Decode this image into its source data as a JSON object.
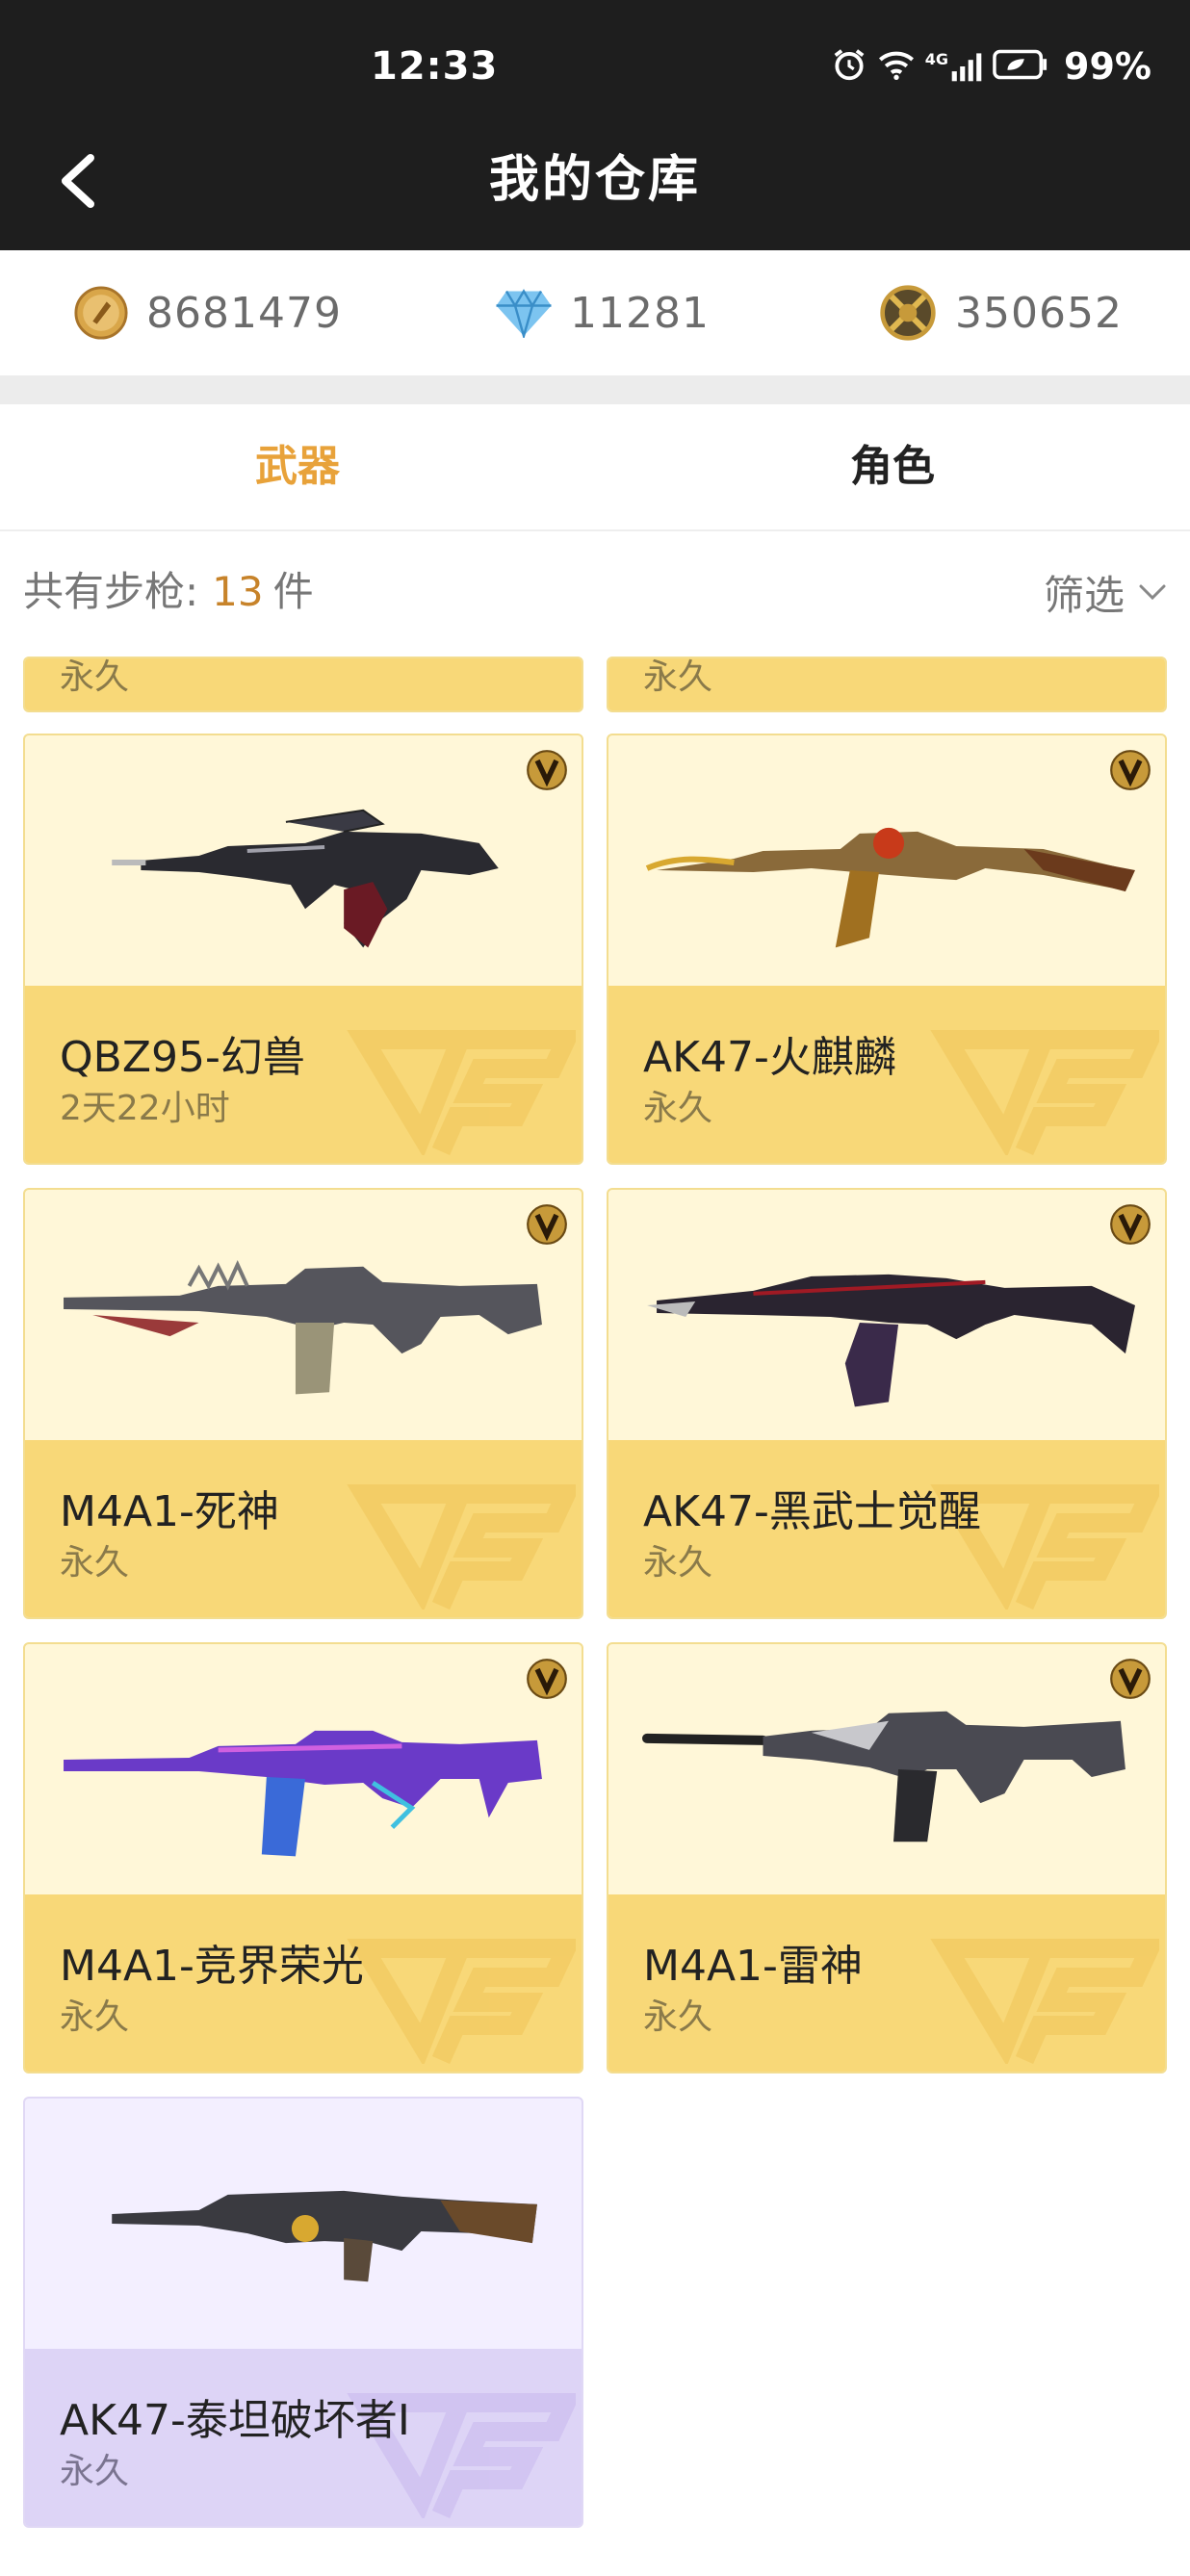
{
  "status_bar": {
    "time": "12:33",
    "battery": "99%",
    "network": "4G"
  },
  "header": {
    "title": "我的仓库"
  },
  "currencies": [
    {
      "icon": "gold-coin-icon",
      "value": "8681479"
    },
    {
      "icon": "diamond-icon",
      "value": "11281"
    },
    {
      "icon": "honor-medal-icon",
      "value": "350652"
    }
  ],
  "tabs": [
    {
      "label": "武器",
      "active": true
    },
    {
      "label": "角色",
      "active": false
    }
  ],
  "summary": {
    "label": "共有步枪:",
    "count": "13",
    "unit": "件",
    "filter_label": "筛选"
  },
  "partial_items": [
    {
      "duration": "永久"
    },
    {
      "duration": "永久"
    }
  ],
  "items": [
    {
      "name": "QBZ95-幻兽",
      "duration": "2天22小时",
      "vip": true,
      "rarity": "gold"
    },
    {
      "name": "AK47-火麒麟",
      "duration": "永久",
      "vip": true,
      "rarity": "gold"
    },
    {
      "name": "M4A1-死神",
      "duration": "永久",
      "vip": true,
      "rarity": "gold"
    },
    {
      "name": "AK47-黑武士觉醒",
      "duration": "永久",
      "vip": true,
      "rarity": "gold"
    },
    {
      "name": "M4A1-竞界荣光",
      "duration": "永久",
      "vip": true,
      "rarity": "gold"
    },
    {
      "name": "M4A1-雷神",
      "duration": "永久",
      "vip": true,
      "rarity": "gold"
    },
    {
      "name": "AK47-泰坦破坏者I",
      "duration": "永久",
      "vip": false,
      "rarity": "purple"
    }
  ],
  "colors": {
    "header_bg": "#1e1e1e",
    "active_tab": "#e8a23a",
    "count_accent": "#c7832a",
    "gold_card_bg": "#fff7d8",
    "gold_card_band": "#f8d878",
    "purple_card_bg": "#f3efff",
    "purple_card_band": "#ddd4f6"
  }
}
